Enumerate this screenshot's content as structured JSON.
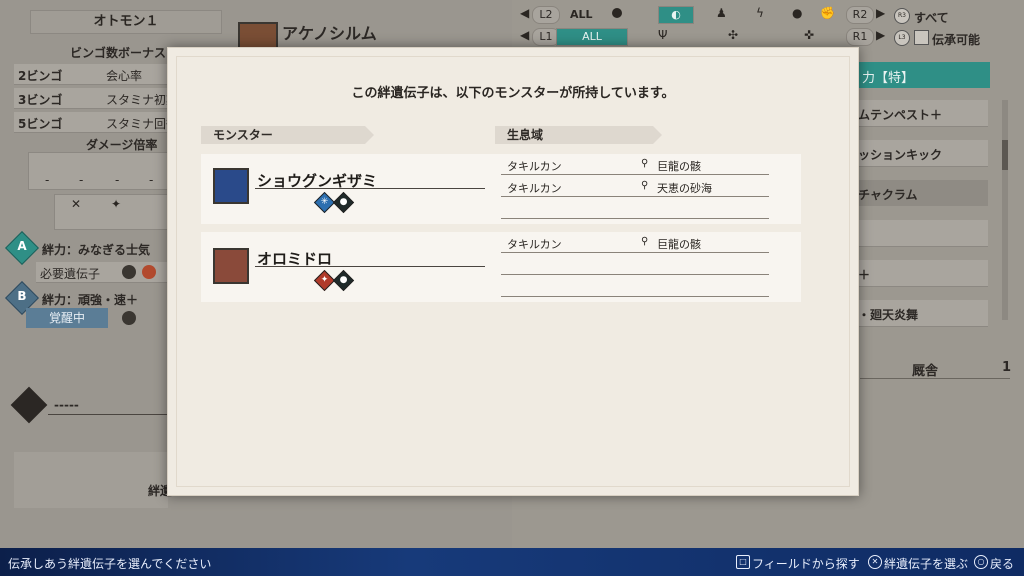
{
  "left_panel": {
    "name_tab": "オトモン１",
    "monster_name": "アケノシルム",
    "bingo_bonus_title": "ビンゴ数ボーナス",
    "bingo_rows": [
      {
        "label": "2ビンゴ",
        "value": "会心率"
      },
      {
        "label": "3ビンゴ",
        "value": "スタミナ初期"
      },
      {
        "label": "5ビンゴ",
        "value": "スタミナ回復"
      }
    ],
    "damage_title": "ダメージ倍率",
    "damage_cells": [
      "-",
      "-",
      "-",
      "-"
    ],
    "skills": [
      {
        "badge": "A",
        "text": "絆力：みなぎる士気"
      },
      {
        "badge": "B",
        "text": "絆力：頑強・速＋"
      }
    ],
    "required_gene": "必要遺伝子",
    "awakened": "覚醒中",
    "empty_slot": "-----",
    "footer_partial": "絆遺"
  },
  "top_filter": {
    "l2": "L2",
    "r2": "R2",
    "l1": "L1",
    "r1": "R1",
    "all_top": "ALL",
    "all_bottom": "ALL",
    "r3": "R3",
    "l3": "L3",
    "all_label": "すべて",
    "inheritable_label": "伝承可能"
  },
  "right_panel": {
    "rows": [
      "力【特】",
      "ムテンペスト＋",
      "ッションキック",
      "チャクラム",
      "",
      "＋",
      "・廻天炎舞"
    ],
    "footer_label": "厩舎",
    "footer_count": "1"
  },
  "dialog": {
    "title": "この絆遺伝子は、以下のモンスターが所持しています。",
    "col_monster": "モンスター",
    "col_habitat": "生息域",
    "monsters": [
      {
        "name": "ショウグンギザミ",
        "elements": [
          "ice-element",
          "water-element"
        ],
        "habitats": [
          {
            "region": "タキルカン",
            "place": "巨龍の骸"
          },
          {
            "region": "タキルカン",
            "place": "天恵の砂海"
          }
        ]
      },
      {
        "name": "オロミドロ",
        "elements": [
          "fire-element",
          "water-element"
        ],
        "habitats": [
          {
            "region": "タキルカン",
            "place": "巨龍の骸"
          }
        ]
      }
    ]
  },
  "bottom_bar": {
    "instruction": "伝承しあう絆遺伝子を選んでください",
    "action_search": "フィールドから探す",
    "action_select": "絆遺伝子を選ぶ",
    "action_back": "戻る"
  },
  "colors": {
    "accent": "#2f8f86",
    "bottom_bar": "#173a7a",
    "dialog_bg": "#f0ebe2"
  }
}
